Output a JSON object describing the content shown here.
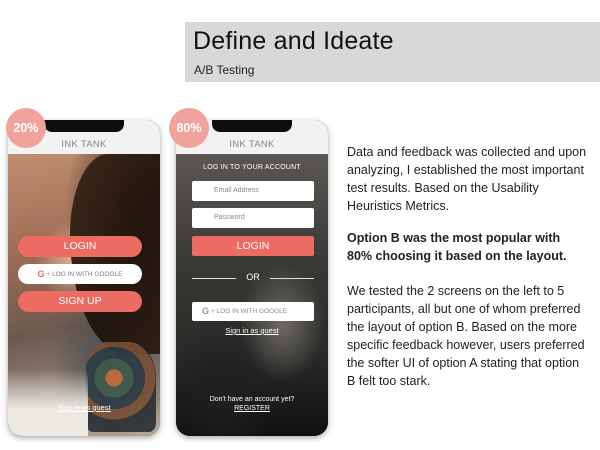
{
  "header": {
    "title": "Define and Ideate",
    "subtitle": "A/B Testing"
  },
  "option_a": {
    "badge": "20%",
    "app_name": "INK TANK",
    "login_label": "LOGIN",
    "google_label": "LOG IN WITH GOOGLE",
    "signup_label": "SIGN UP",
    "guest_label": "Sign in as guest"
  },
  "option_b": {
    "badge": "80%",
    "app_name": "INK TANK",
    "heading": "LOG IN TO YOUR ACCOUNT",
    "email_placeholder": "Email Address",
    "password_placeholder": "Password",
    "login_label": "LOGIN",
    "or_label": "OR",
    "google_label": "LOG IN WITH GOOGLE",
    "guest_label": "Sign in as guest",
    "no_account_label": "Don't have an account yet?",
    "register_label": "REGISTER"
  },
  "body": {
    "paragraph1": "Data and feedback was collected and upon analyzing, I established the most important test results. Based on the Usability Heuristics Metrics.",
    "paragraph2": "Option B was the most popular with 80% choosing it based on the layout.",
    "paragraph3": "We tested the 2 screens on the left to 5 participants, all but one of whom preferred the layout of option B. Based on the more specific feedback however, users preferred the softer UI of option A stating that option B felt too stark."
  },
  "colors": {
    "accent": "#ec6b63",
    "badge": "#f0a39c",
    "header_band": "#d8d8d8"
  },
  "icons": {
    "google": "google-g-icon"
  }
}
